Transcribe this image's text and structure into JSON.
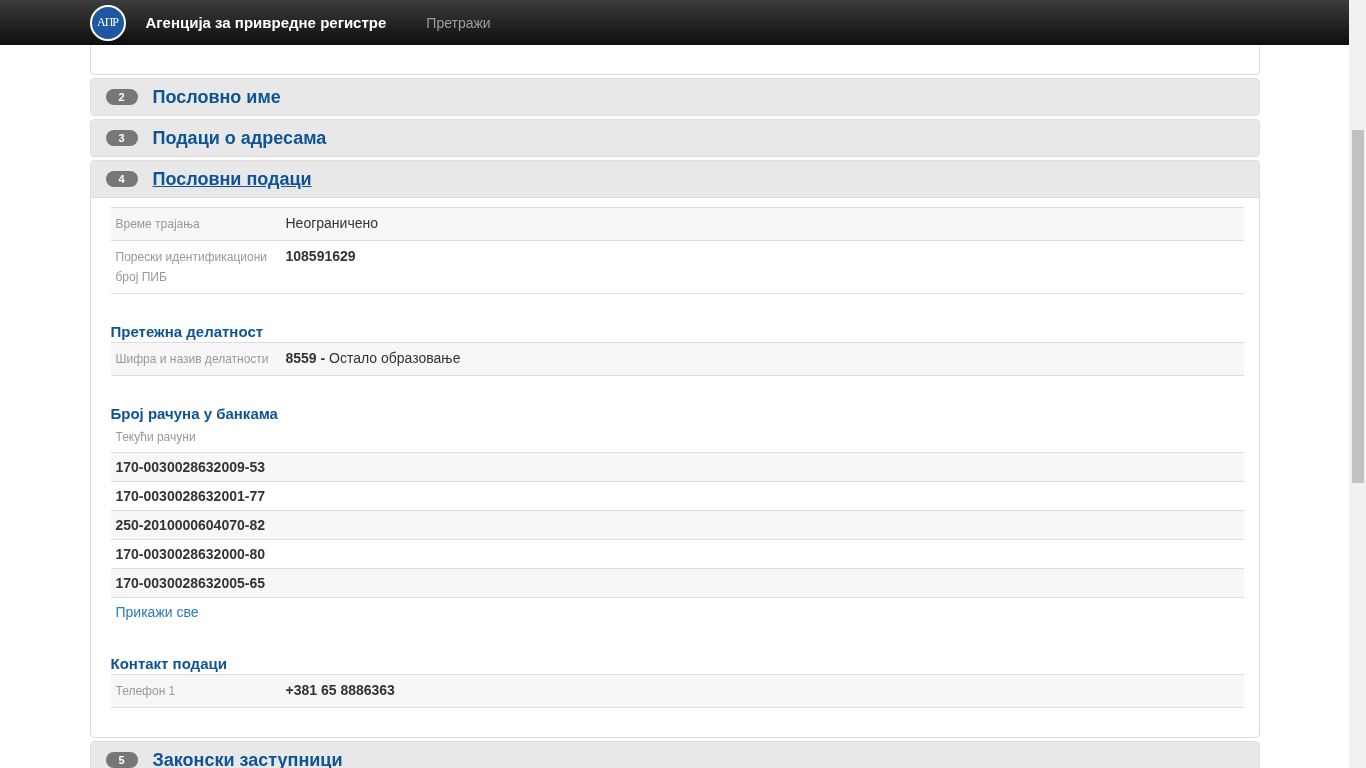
{
  "navbar": {
    "logo_text": "АПР",
    "brand": "Агенција за привредне регистре",
    "links": [
      {
        "label": "Претражи"
      }
    ]
  },
  "panels": [
    {
      "number": "2",
      "title": "Пословно име",
      "expanded": false
    },
    {
      "number": "3",
      "title": "Подаци о адресама",
      "expanded": false
    },
    {
      "number": "4",
      "title": "Пословни подаци",
      "expanded": true,
      "sections": [
        {
          "kind": "fields",
          "rows": [
            {
              "label": "Време трајања",
              "value": "Неограничено",
              "bold": false
            },
            {
              "label": "Порески идентификациони број ПИБ",
              "value": "108591629",
              "bold": true
            }
          ]
        },
        {
          "kind": "fields",
          "heading": "Претежна делатност",
          "rows": [
            {
              "label": "Шифра и назив делатности",
              "value": "**8559 -** Остало образовање",
              "bold": false
            }
          ]
        },
        {
          "kind": "list",
          "heading": "Број рачуна у банкама",
          "subheading": "Текући рачуни",
          "items": [
            "170-0030028632009-53",
            "170-0030028632001-77",
            "250-2010000604070-82",
            "170-0030028632000-80",
            "170-0030028632005-65"
          ],
          "link": "Прикажи све"
        },
        {
          "kind": "fields",
          "heading": "Контакт подаци",
          "rows": [
            {
              "label": "Телефон 1",
              "value": "+381 65 8886363",
              "bold": true
            }
          ]
        }
      ]
    },
    {
      "number": "5",
      "title": "Законски заступници",
      "expanded": false
    }
  ]
}
